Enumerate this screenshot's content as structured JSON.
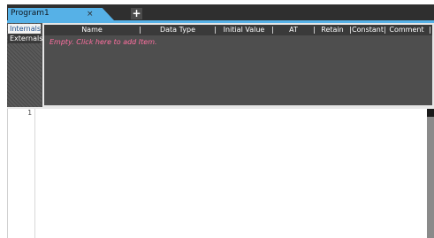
{
  "tabs": {
    "active": {
      "label": "Program1",
      "close": "×"
    },
    "add": "+"
  },
  "sidebar": {
    "items": [
      {
        "label": "Internals",
        "active": true
      },
      {
        "label": "Externals",
        "active": false
      }
    ]
  },
  "variables": {
    "columns": [
      "Name",
      "Data Type",
      "Initial Value",
      "AT",
      "Retain",
      "Constant",
      "Comment"
    ],
    "empty_message": "Empty. Click here to add Item."
  },
  "editor": {
    "line_numbers": [
      "1"
    ]
  },
  "colors": {
    "tab_accent": "#56b1e7",
    "empty_text": "#ff6fa0",
    "panel_bg": "#4a4a4a"
  }
}
